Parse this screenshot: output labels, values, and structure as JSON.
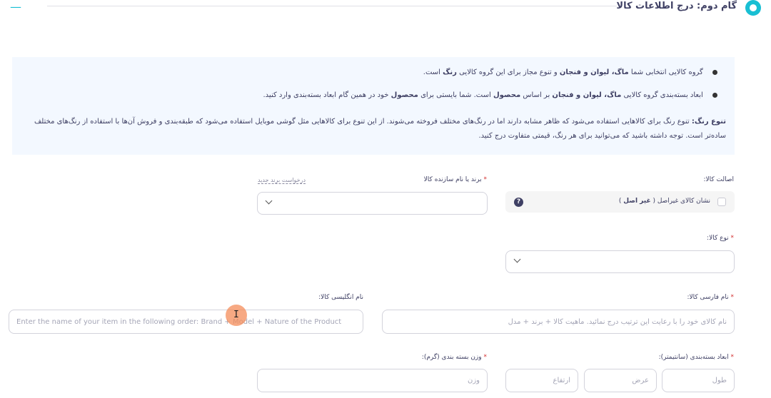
{
  "header": {
    "title": "گام دوم: درج اطلاعات کالا",
    "collapse_icon": "minus-icon",
    "step_icon": "step-circle-icon",
    "accent": "#19bfd3"
  },
  "info": {
    "bullet1": {
      "pre": "گروه کالایی انتخابی شما",
      "group": "ماگ، لیوان و فنجان",
      "mid": "و تنوع مجاز برای این گروه کالایی",
      "variant": "رنگ",
      "post": "است."
    },
    "bullet2": {
      "pre": "ابعاد بسته‌بندی گروه کالایی",
      "group": "ماگ، لیوان و فنجان",
      "mid": "بر اساس",
      "basis": "محصول",
      "mid2": "است. شما بایستی برای",
      "target": "محصول",
      "post": "خود در همین گام ابعاد بسته‌بندی وارد کنید."
    },
    "note_title": "تنوع رنگ:",
    "note_text": "تنوع رنگ برای کالاهایی استفاده می‌شود که ظاهر مشابه دارند اما در رنگ‌های مختلف فروخته می‌شوند. از این تنوع برای کالاهایی مثل گوشی موبایل استفاده می‌شود که طبقه‌بندی و فروش آن‌ها با استفاده از رنگ‌های مختلف ساده‌تر است. توجه داشته باشید که می‌توانید برای هر رنگ، قیمتی متفاوت درج کنید.",
    "background": "#f3f8ff"
  },
  "form": {
    "originality": {
      "label": "اصالت کالا:",
      "checkbox_text": "نشان کالای غیراصل (",
      "checkbox_bold": "غیر اصل",
      "checkbox_close": ")",
      "help": "?"
    },
    "brand": {
      "label": "برند یا نام سازنده کالا",
      "required": "*",
      "request_link": "درخواست برند جدید",
      "value": ""
    },
    "product_type": {
      "label": "نوع کالا:",
      "required": "*",
      "value": ""
    },
    "persian_name": {
      "label": "نام فارسی کالا:",
      "required": "*",
      "placeholder": "نام کالای خود را با رعایت این ترتیب درج نمائید. ماهیت کالا + برند + مدل",
      "value": ""
    },
    "english_name": {
      "label": "نام انگلیسی کالا:",
      "placeholder": "Enter the name of your item in the following order: Brand + Model + Nature of the Product",
      "value": ""
    },
    "dimensions": {
      "label": "ابعاد بسته‌بندی (سانتیمتر):",
      "required": "*",
      "length_placeholder": "طول",
      "width_placeholder": "عرض",
      "height_placeholder": "ارتفاع"
    },
    "weight": {
      "label": "وزن بسته بندی (گرم):",
      "required": "*",
      "placeholder": "وزن"
    }
  }
}
